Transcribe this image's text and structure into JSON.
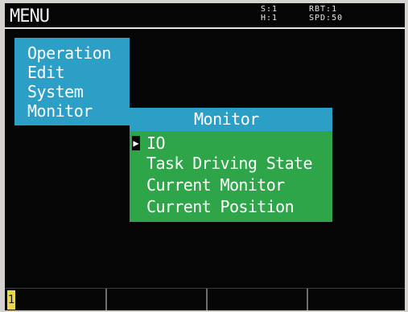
{
  "header": {
    "title": "MENU",
    "status_left": [
      "S:1",
      "H:1"
    ],
    "status_right": [
      "RBT:1",
      "SPD:50"
    ]
  },
  "main_menu": {
    "items": [
      {
        "label": "Operation"
      },
      {
        "label": "Edit"
      },
      {
        "label": "System"
      },
      {
        "label": "Monitor"
      }
    ],
    "selected": "Monitor"
  },
  "submenu": {
    "title": "Monitor",
    "cursor_glyph": "▶",
    "items": [
      {
        "label": "IO"
      },
      {
        "label": "Task Driving State"
      },
      {
        "label": "Current Monitor"
      },
      {
        "label": "Current Position"
      }
    ],
    "selected_index": 0
  },
  "function_bar": {
    "marker": "1"
  },
  "colors": {
    "screen_bg": "#050505",
    "main_menu_bg": "#2b9fc6",
    "submenu_bg": "#2fa54a",
    "marker_bg": "#e8d84a",
    "text": "#ffffff"
  }
}
